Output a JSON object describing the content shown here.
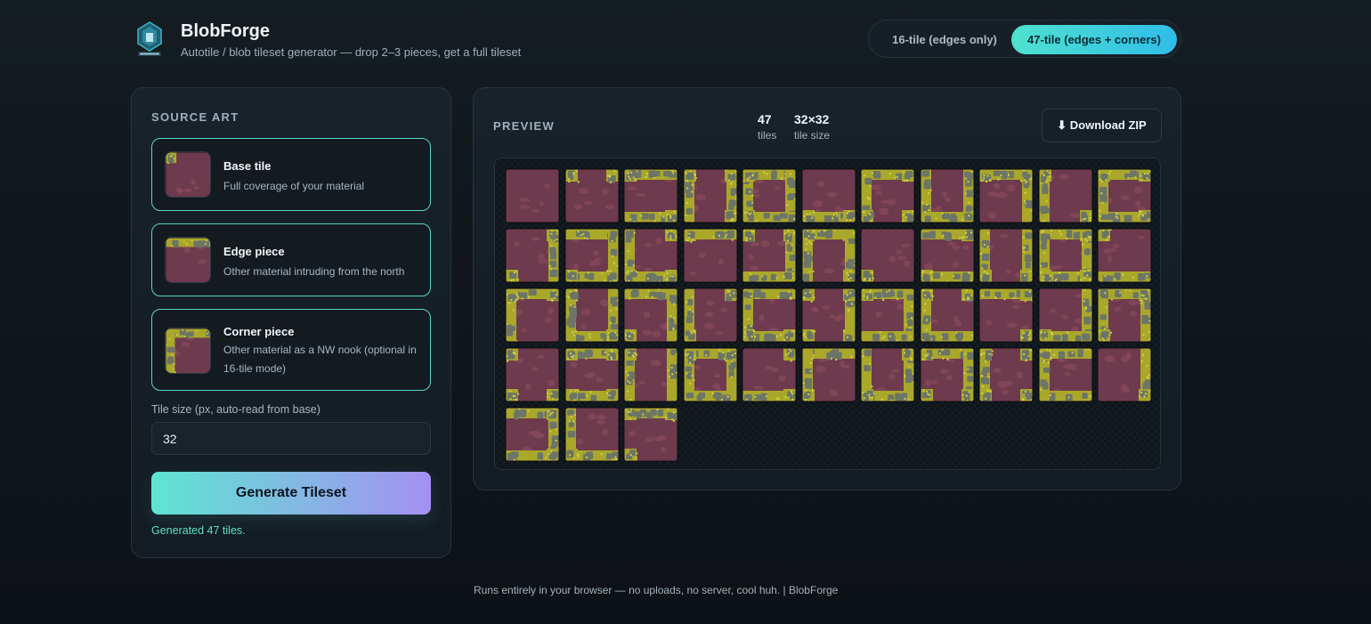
{
  "app": {
    "name": "BlobForge",
    "tagline": "Autotile / blob tileset generator — drop 2–3 pieces, get a full tileset"
  },
  "modes": {
    "option_16": "16-tile (edges only)",
    "option_47": "47-tile (edges + corners)",
    "selected": "47-tile (edges + corners)"
  },
  "source": {
    "heading": "SOURCE ART",
    "cards": [
      {
        "title": "Base tile",
        "description": "Full coverage of your material"
      },
      {
        "title": "Edge piece",
        "description": "Other material intruding from the north"
      },
      {
        "title": "Corner piece",
        "description": "Other material as a NW nook (optional in 16-tile mode)"
      }
    ],
    "tile_size_label": "Tile size (px, auto-read from base)",
    "tile_size_value": "32",
    "generate_label": "Generate Tileset",
    "status": "Generated 47 tiles."
  },
  "preview": {
    "heading": "PREVIEW",
    "tile_count": "47",
    "tile_count_label": "tiles",
    "tile_size": "32×32",
    "tile_size_label": "tile size",
    "download_label": "⬇ Download ZIP",
    "tiles_rendered": 47
  },
  "footer": {
    "text": "Runs entirely in your browser — no uploads, no server, cool huh.  |  BlobForge"
  },
  "colors": {
    "accent": "#57d6c2",
    "material_base": "#6e3a4d",
    "material_other": "#a9a82a",
    "stone": "#6c7566"
  }
}
